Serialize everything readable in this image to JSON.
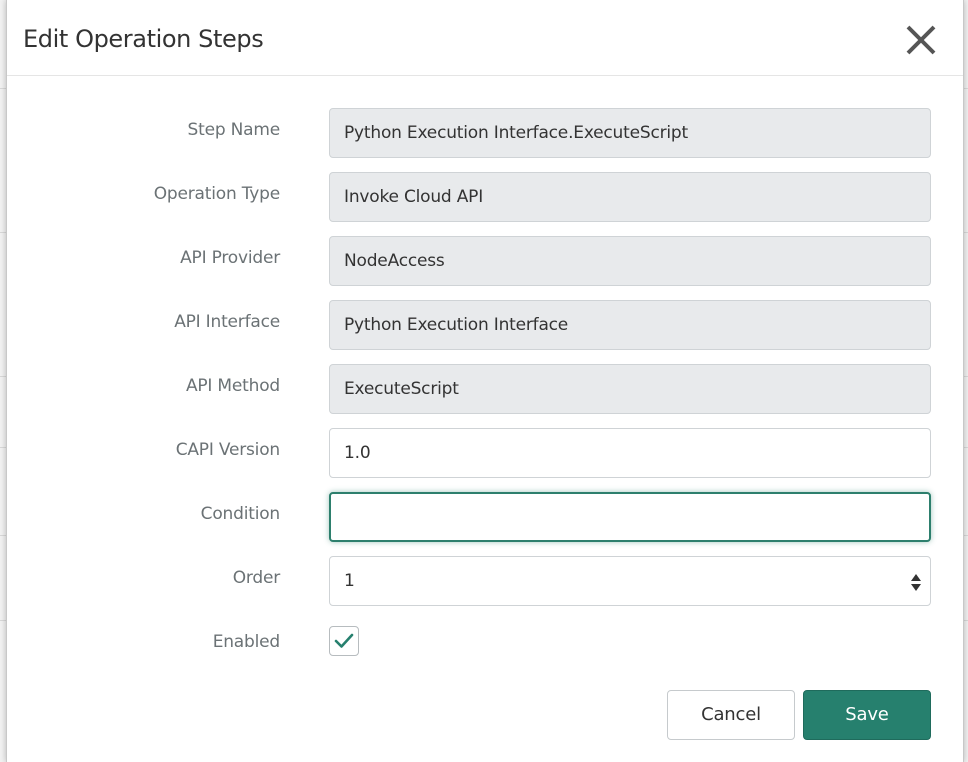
{
  "dialog": {
    "title": "Edit Operation Steps",
    "close_icon": "close-icon"
  },
  "fields": [
    {
      "label": "Step Name",
      "value": "Python Execution Interface.ExecuteScript",
      "readonly": true
    },
    {
      "label": "Operation Type",
      "value": "Invoke Cloud API",
      "readonly": true
    },
    {
      "label": "API Provider",
      "value": "NodeAccess",
      "readonly": true
    },
    {
      "label": "API Interface",
      "value": "Python Execution Interface",
      "readonly": true
    },
    {
      "label": "API Method",
      "value": "ExecuteScript",
      "readonly": true
    },
    {
      "label": "CAPI Version",
      "value": "1.0",
      "readonly": false
    },
    {
      "label": "Condition",
      "value": "",
      "readonly": false
    },
    {
      "label": "Order",
      "value": "1",
      "readonly": false
    }
  ],
  "enabled": {
    "label": "Enabled",
    "checked": true,
    "icon": "checkmark-icon"
  },
  "buttons": {
    "cancel_label": "Cancel",
    "save_label": "Save"
  },
  "colors": {
    "accent": "#26806e",
    "readonly_bg": "#e8eaec",
    "label_text": "#6b7275"
  }
}
